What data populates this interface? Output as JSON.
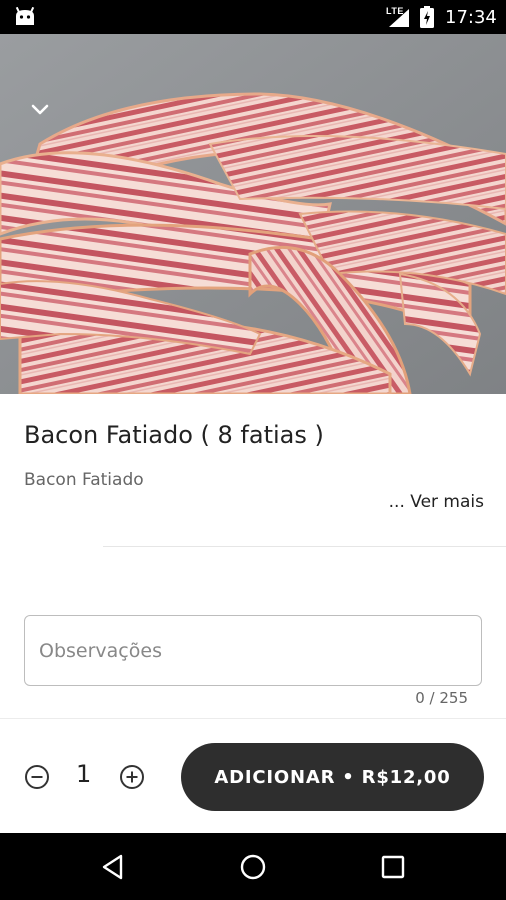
{
  "status_bar": {
    "network": "LTE",
    "time": "17:34",
    "icons": [
      "android-icon",
      "signal-icon",
      "battery-icon"
    ]
  },
  "header": {
    "collapse_icon": "chevron-down-icon"
  },
  "product": {
    "title": "Bacon Fatiado ( 8 fatias )",
    "description": "Bacon Fatiado",
    "more_link": "... Ver mais"
  },
  "notes": {
    "placeholder": "Observações",
    "value": "",
    "counter": "0 / 255"
  },
  "order": {
    "quantity": "1",
    "add_button_label": "ADICIONAR • R$12,00",
    "minus_icon": "minus-circle-icon",
    "plus_icon": "plus-circle-icon"
  },
  "navigation": {
    "buttons": [
      "back-icon",
      "home-icon",
      "recents-icon"
    ]
  },
  "colors": {
    "button_bg": "#2e2e2e",
    "background": "#ffffff",
    "status_bar": "#000000"
  }
}
